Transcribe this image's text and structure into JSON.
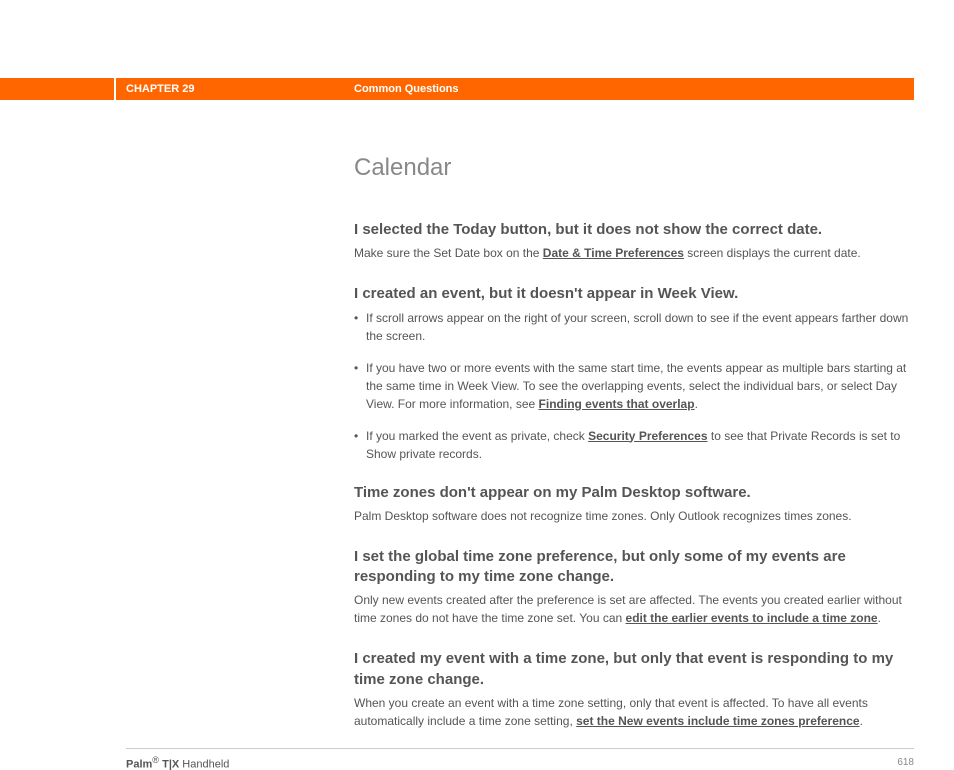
{
  "header": {
    "chapter": "CHAPTER 29",
    "section": "Common Questions"
  },
  "title": "Calendar",
  "qa": [
    {
      "q": "I selected the Today button, but it does not show the correct date.",
      "p_before": "Make sure the Set Date box on the ",
      "link": "Date & Time Preferences",
      "p_after": " screen displays the current date."
    },
    {
      "q": "I created an event, but it doesn't appear in Week View.",
      "bullets": [
        {
          "text": "If scroll arrows appear on the right of your screen, scroll down to see if the event appears farther down the screen."
        },
        {
          "before": "If you have two or more events with the same start time, the events appear as multiple bars starting at the same time in Week View. To see the overlapping events, select the individual bars, or select Day View. For more information, see ",
          "link": "Finding events that overlap",
          "after": "."
        },
        {
          "before": "If you marked the event as private, check ",
          "link": "Security Preferences",
          "after": " to see that Private Records is set to Show private records."
        }
      ]
    },
    {
      "q": "Time zones don't appear on my Palm Desktop software.",
      "p": "Palm Desktop software does not recognize time zones. Only Outlook recognizes times zones."
    },
    {
      "q": "I set the global time zone preference, but only some of my events are responding to my time zone change.",
      "p_before": "Only new events created after the preference is set are affected. The events you created earlier without time zones do not have the time zone set. You can ",
      "link": "edit the earlier events to include a time zone",
      "p_after": "."
    },
    {
      "q": "I created my event with a time zone, but only that event is responding to my time zone change.",
      "p_before": "When you create an event with a time zone setting, only that event is affected. To have all events automatically include a time zone setting, ",
      "link": "set the New events include time zones preference",
      "p_after": "."
    }
  ],
  "footer": {
    "brand_prefix": "Palm",
    "reg": "®",
    "model": " T|X",
    "suffix": " Handheld",
    "page": "618"
  }
}
